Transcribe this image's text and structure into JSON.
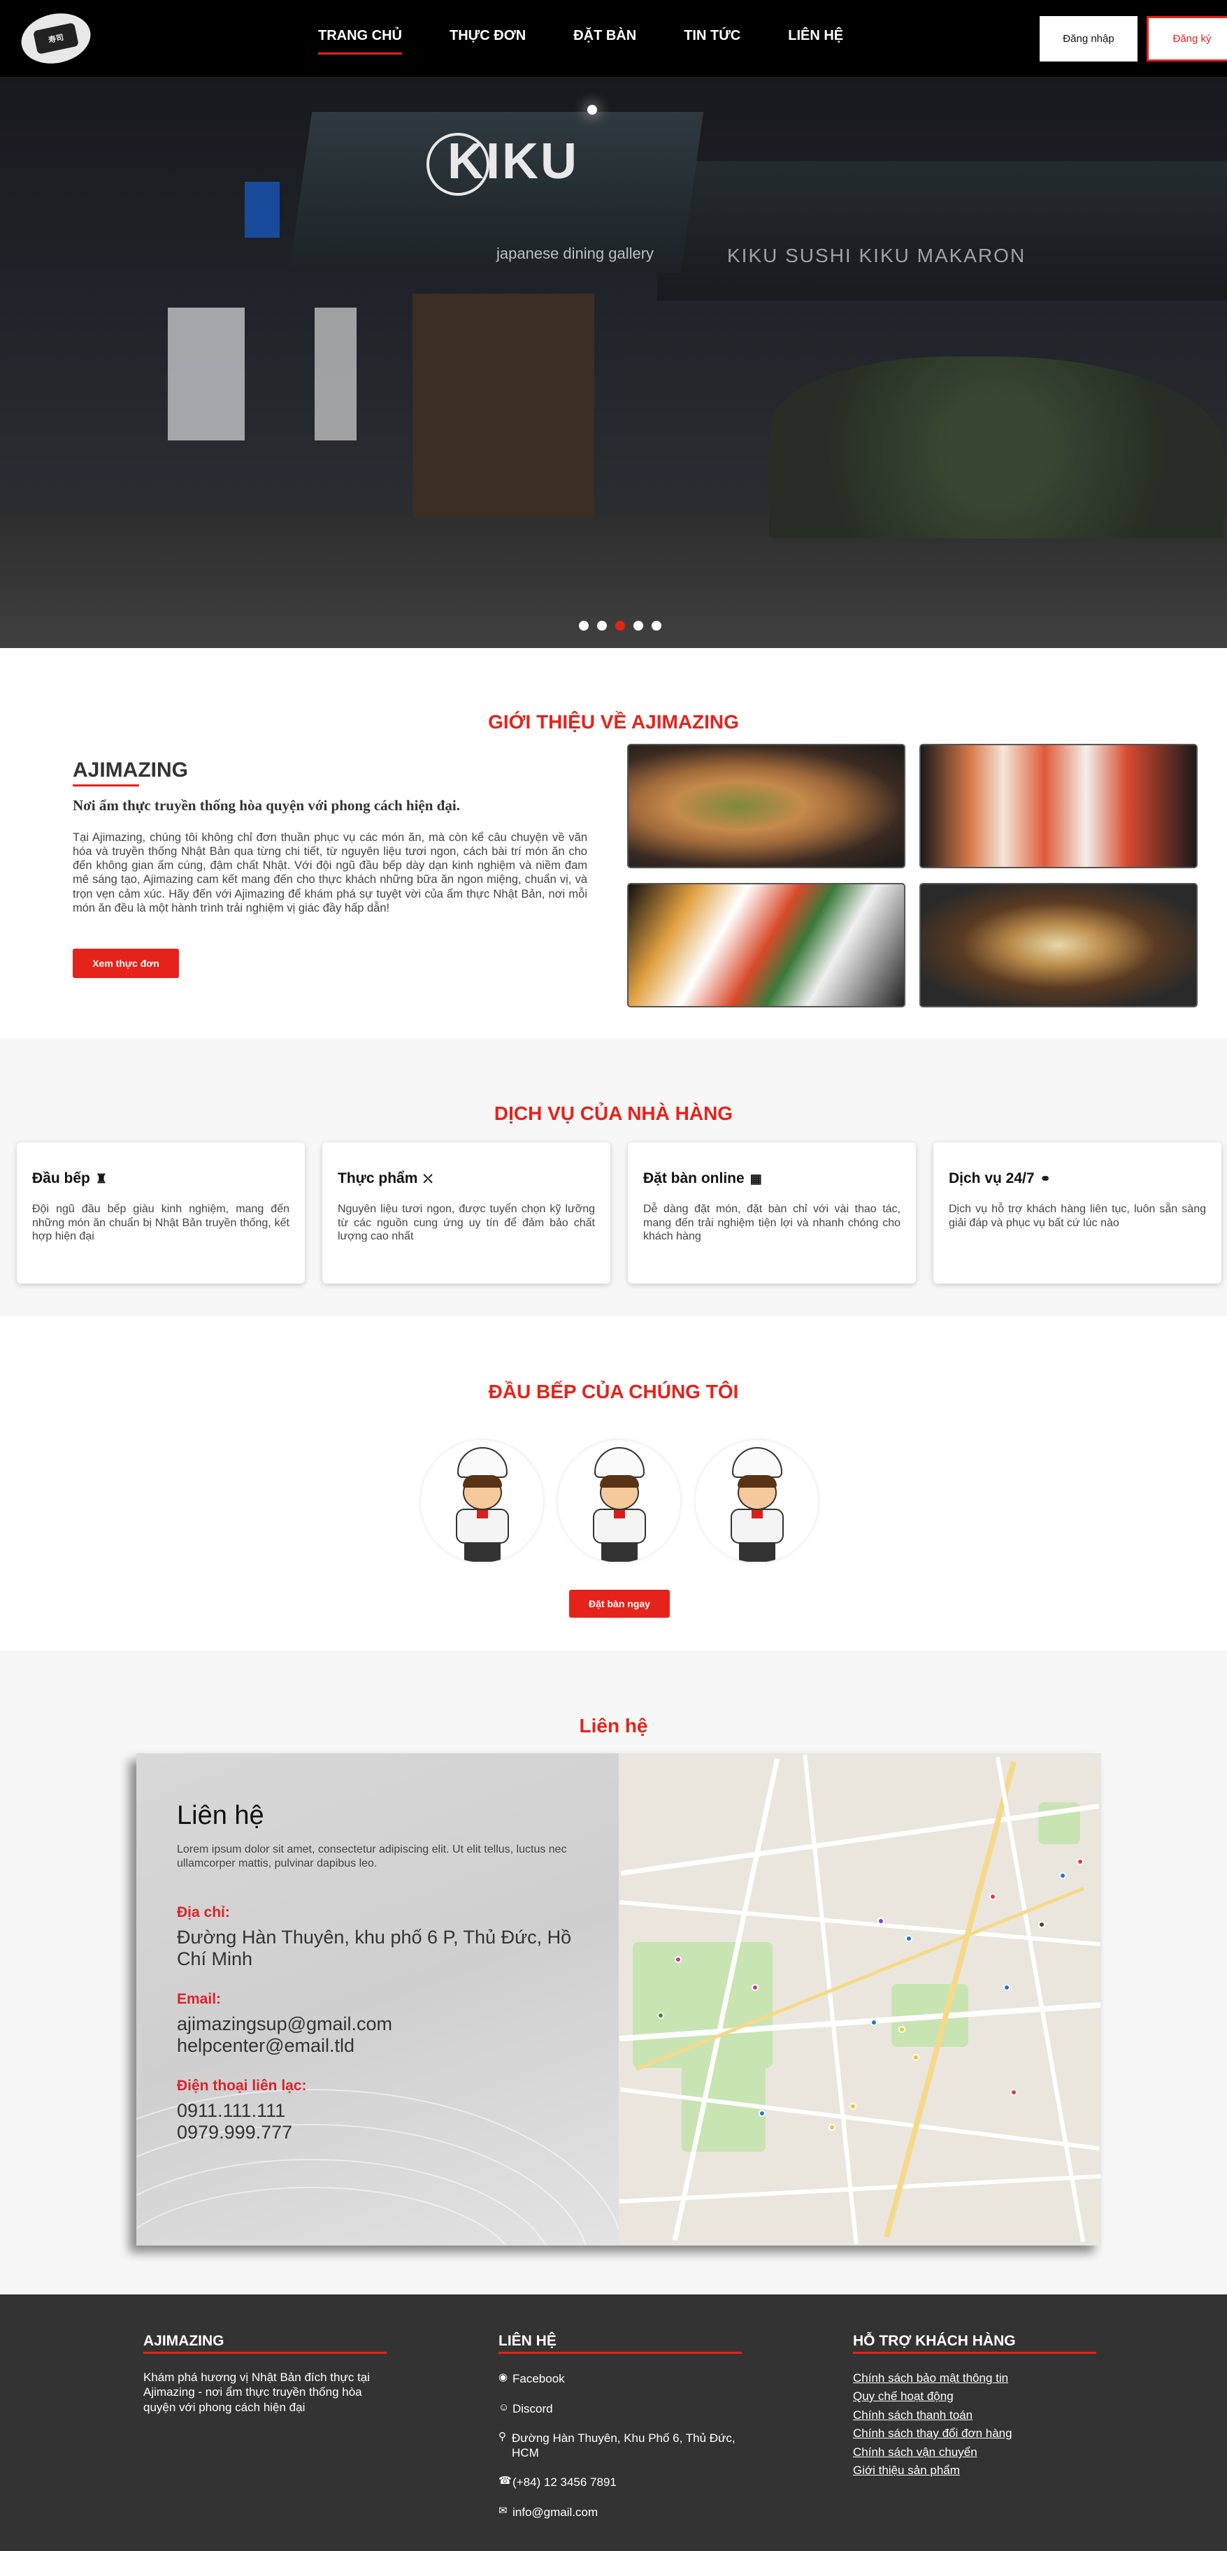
{
  "header": {
    "logo_text": "寿司",
    "nav": [
      "TRANG CHỦ",
      "THỰC ĐƠN",
      "ĐẶT BÀN",
      "TIN TỨC",
      "LIÊN HỆ"
    ],
    "login_label": "Đăng nhập",
    "register_label": "Đăng ký"
  },
  "hero": {
    "sign_text": "KIKU",
    "subtitle": "japanese dining gallery",
    "sub2": "KIKU SUSHI   KIKU MAKARON",
    "slide_count": 5,
    "active_slide": 3
  },
  "intro": {
    "title": "GIỚI THIỆU VỀ AJIMAZING",
    "brand": "AJIMAZING",
    "tagline": "Nơi ẩm thực truyền thống hòa quyện với phong cách hiện đại.",
    "body": "Tại Ajimazing, chúng tôi không chỉ đơn thuần phục vụ các món ăn, mà còn kể câu chuyện về văn hóa và truyền thống Nhật Bản qua từng chi tiết, từ nguyên liệu tươi ngon, cách bài trí món ăn cho đến không gian ấm cúng, đậm chất Nhật. Với đội ngũ đầu bếp dày dạn kinh nghiệm và niềm đam mê sáng tạo, Ajimazing cam kết mang đến cho thực khách những bữa ăn ngon miệng, chuẩn vị, và trọn vẹn cảm xúc. Hãy đến với Ajimazing để khám phá sự tuyệt vời của ẩm thực Nhật Bản, nơi mỗi món ăn đều là một hành trình trải nghiệm vị giác đầy hấp dẫn!",
    "button": "Xem thực đơn"
  },
  "services": {
    "title": "DỊCH VỤ CỦA NHÀ HÀNG",
    "items": [
      {
        "title": "Đầu bếp",
        "icon": "chef-hat-icon",
        "text": "Đội ngũ đầu bếp giàu kinh nghiệm, mang đến những món ăn chuẩn bị Nhật Bản truyền thống, kết hợp hiện đại"
      },
      {
        "title": "Thực phẩm",
        "icon": "utensils-icon",
        "text": "Nguyên liệu tươi ngon, được tuyển chọn kỹ lưỡng từ các nguồn cung ứng uy tín để đảm bảo chất lượng cao nhất"
      },
      {
        "title": "Đặt bàn online",
        "icon": "calendar-icon",
        "text": "Dễ dàng đặt món, đặt bàn chỉ với vài thao tác, mang đến trải nghiệm tiện lợi và nhanh chóng cho khách hàng"
      },
      {
        "title": "Dịch vụ 24/7",
        "icon": "headset-icon",
        "text": "Dịch vụ hỗ trợ khách hàng liên tục, luôn sẵn sàng giải đáp và phục vụ bất cứ lúc nào"
      }
    ]
  },
  "chefs": {
    "title": "ĐẦU BẾP CỦA CHÚNG TÔI",
    "button": "Đặt bàn ngay"
  },
  "contact": {
    "section_title": "Liên hệ",
    "heading": "Liên hệ",
    "lorem": "Lorem ipsum dolor sit amet, consectetur adipiscing elit. Ut elit tellus, luctus nec ullamcorper mattis, pulvinar dapibus leo.",
    "address_label": "Địa chỉ:",
    "address": "Đường Hàn Thuyên, khu phố 6 P, Thủ Đức, Hồ Chí Minh",
    "email_label": "Email:",
    "email1": "ajimazingsup@gmail.com",
    "email2": "helpcenter@email.tld",
    "phone_label": "Điện thoại liên lạc:",
    "phone1": "0911.111.111",
    "phone2": "0979.999.777"
  },
  "footer": {
    "about_title": "AJIMAZING",
    "about_text": "Khám phá hương vị Nhật Bản đích thực tại Ajimazing - nơi ẩm thực truyền thống hòa quyện với phong cách hiện đại",
    "contact_title": "LIÊN HỆ",
    "facebook": "Facebook",
    "discord": "Discord",
    "address": "Đường Hàn Thuyên, Khu Phố 6, Thủ Đức, HCM",
    "phone": "(+84) 12 3456 7891",
    "email": "info@gmail.com",
    "support_title": "HỖ TRỢ KHÁCH HÀNG",
    "links": [
      "Chính sách bảo mật thông tin",
      "Quy chế hoạt động",
      "Chính sách thanh toán",
      "Chính sách thay đổi đơn hàng",
      "Chính sách vận chuyển",
      "Giới thiệu sản phẩm"
    ]
  },
  "colors": {
    "accent": "#e5231b",
    "header_bg": "#000000",
    "footer_bg": "#333333"
  }
}
